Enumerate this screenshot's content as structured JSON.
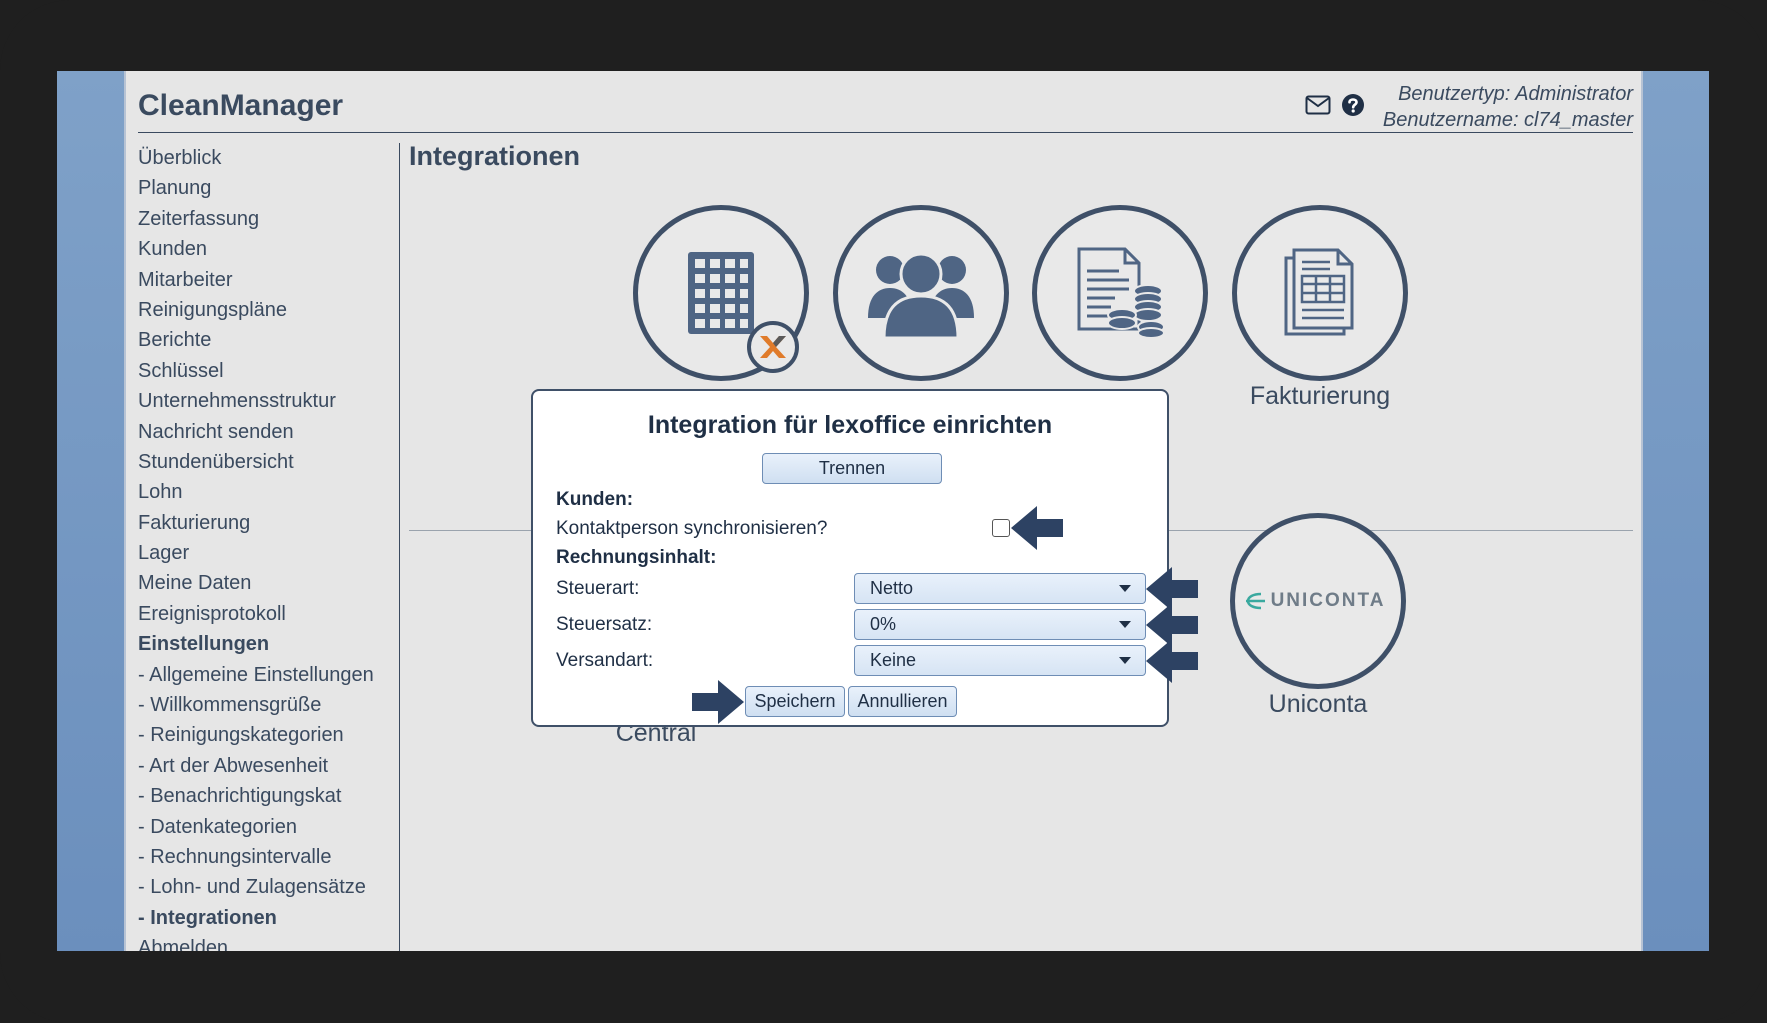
{
  "app": {
    "logo": "CleanManager",
    "user_type": "Benutzertyp: Administrator",
    "user_name": "Benutzername: cl74_master"
  },
  "sidebar": {
    "items": [
      "Überblick",
      "Planung",
      "Zeiterfassung",
      "Kunden",
      "Mitarbeiter",
      "Reinigungspläne",
      "Berichte",
      "Schlüssel",
      "Unternehmensstruktur",
      "Nachricht senden",
      "Stundenübersicht",
      "Lohn",
      "Fakturierung",
      "Lager",
      "Meine Daten",
      "Ereignisprotokoll",
      "Einstellungen",
      "- Allgemeine Einstellungen",
      "- Willkommensgrüße",
      "- Reinigungskategorien",
      "- Art der Abwesenheit",
      "- Benachrichtigungskat",
      "- Datenkategorien",
      "- Rechnungsintervalle",
      "- Lohn- und Zulagensätze",
      "- Integrationen",
      "Abmelden"
    ]
  },
  "main": {
    "title": "Integrationen",
    "tiles": [
      "Fakturierung",
      "Uniconta",
      "Central"
    ],
    "uniconta_logo": "UNICONTA"
  },
  "modal": {
    "title": "Integration für lexoffice einrichten",
    "disconnect_button": "Trennen",
    "section_customers": "Kunden:",
    "sync_contact_label": "Kontaktperson synchronisieren?",
    "sync_contact_checked": false,
    "section_invoice": "Rechnungsinhalt:",
    "tax_type_label": "Steuerart:",
    "tax_type_value": "Netto",
    "tax_rate_label": "Steuersatz:",
    "tax_rate_value": "0%",
    "shipping_label": "Versandart:",
    "shipping_value": "Keine",
    "save_button": "Speichern",
    "cancel_button": "Annullieren"
  },
  "colors": {
    "accent_dark": "#3f5068",
    "arrow": "#2d4263",
    "button_border": "#6e8db5",
    "exact_orange": "#e07b2a"
  }
}
